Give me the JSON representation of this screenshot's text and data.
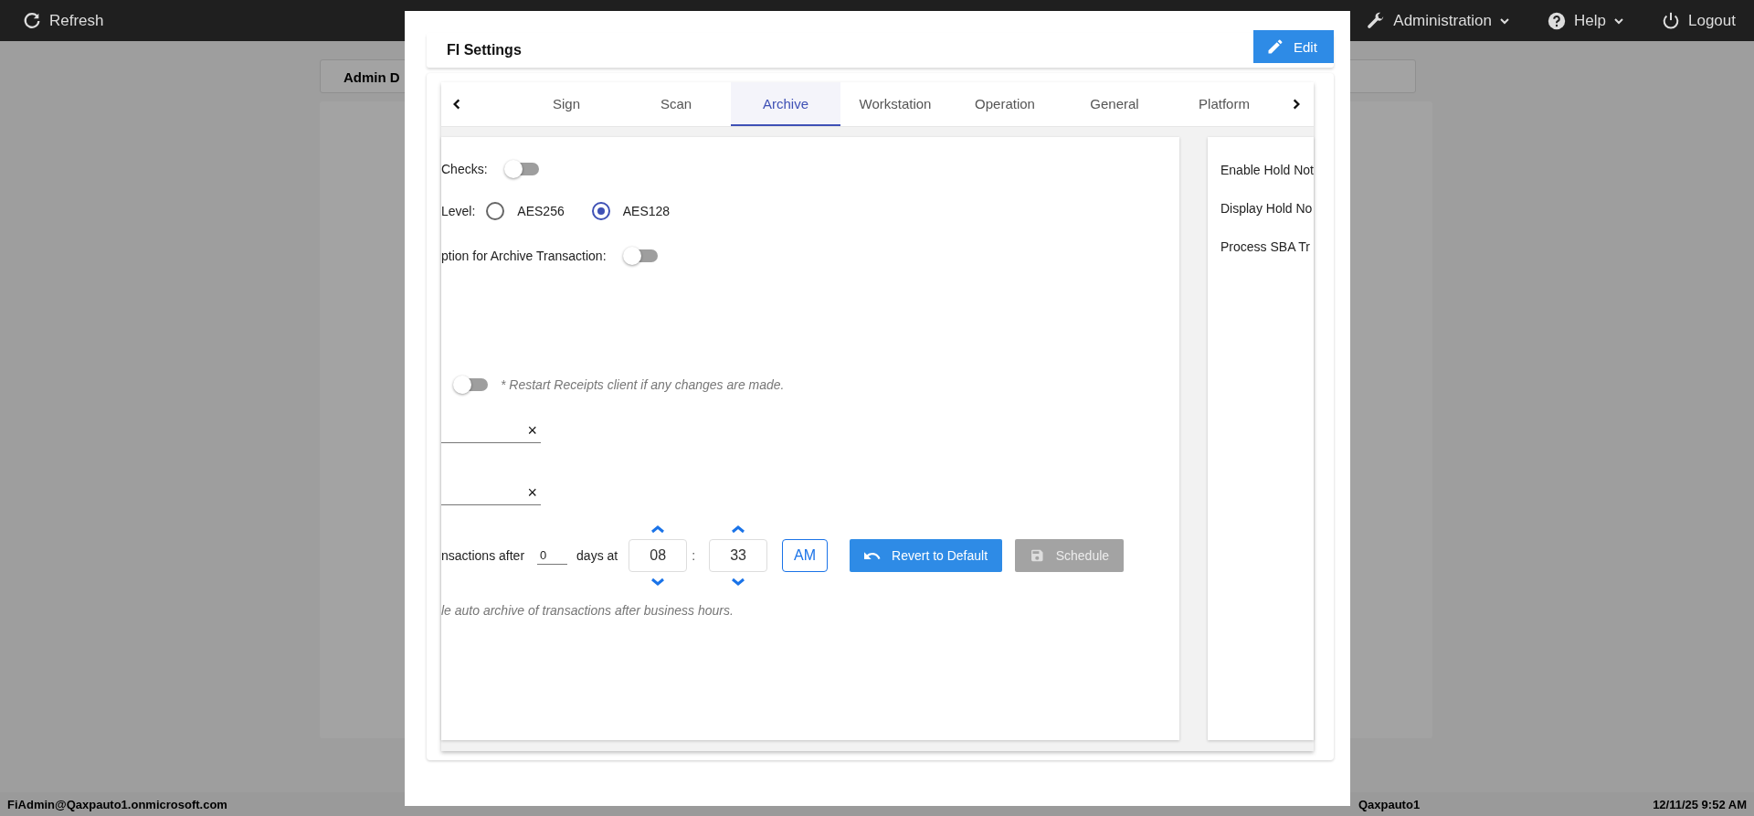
{
  "top_bar": {
    "refresh": "Refresh",
    "menus": [
      {
        "label": "Administration",
        "kind": "wrench",
        "dropdown": true
      },
      {
        "label": "Help",
        "kind": "help",
        "dropdown": true
      },
      {
        "label": "Logout",
        "kind": "power",
        "dropdown": false
      }
    ]
  },
  "background": {
    "tab_label": "Admin D"
  },
  "dialog": {
    "title": "FI Settings",
    "edit_button": "Edit",
    "tabs": [
      {
        "label": "Sign",
        "selected": false
      },
      {
        "label": "Scan",
        "selected": false
      },
      {
        "label": "Archive",
        "selected": true
      },
      {
        "label": "Workstation",
        "selected": false
      },
      {
        "label": "Operation",
        "selected": false
      },
      {
        "label": "General",
        "selected": false
      },
      {
        "label": "Platform",
        "selected": false
      }
    ],
    "settings": [
      {
        "kind": "toggle",
        "label": "Checks:",
        "on": false
      },
      {
        "kind": "radio",
        "label": "Level:",
        "options": [
          {
            "label": "AES256",
            "selected": false
          },
          {
            "label": "AES128",
            "selected": true
          }
        ]
      },
      {
        "kind": "toggle",
        "label": "ption for Archive Transaction:",
        "on": false
      },
      {
        "kind": "toggle",
        "note": "* Restart Receipts client if any changes are made.",
        "on": false
      }
    ],
    "fields": [
      {
        "clear": "×"
      },
      {
        "clear": "×"
      }
    ],
    "schedule": {
      "label": "nsactions after",
      "days": "0",
      "days_label": "days at",
      "hour": "08",
      "separator": ":",
      "minute": "33",
      "meridiem": "AM",
      "revert": "Revert to Default",
      "schedule": "Schedule",
      "schedule_disabled": true,
      "note": "le auto archive of transactions after business hours."
    },
    "right_panel": [
      "Enable Hold Not",
      "Display Hold No",
      "Process SBA Tr"
    ]
  },
  "status_bar": {
    "user": "FiAdmin@Qaxpauto1.onmicrosoft.com",
    "fi": "Qaxpauto1",
    "time": "12/11/25 9:52 AM"
  }
}
